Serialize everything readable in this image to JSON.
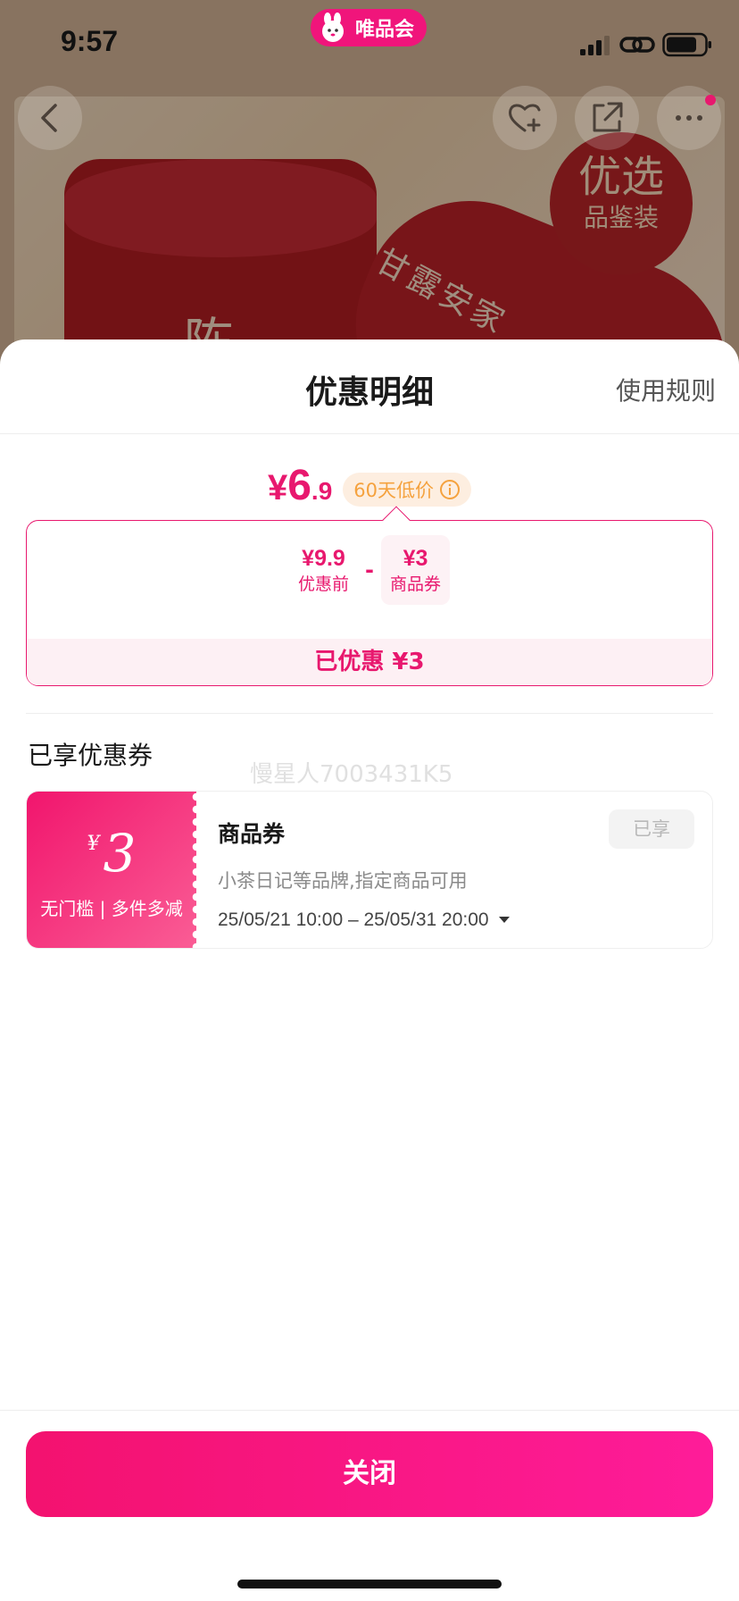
{
  "status_bar": {
    "time": "9:57",
    "app_badge_label": "唯品会"
  },
  "background": {
    "tin_char": "陈",
    "tin2_text": "甘露安家",
    "badge_line1": "优选",
    "badge_line2": "品鉴装"
  },
  "icons": {
    "back": "back-arrow-icon",
    "favorite": "heart-plus-icon",
    "share": "share-icon",
    "more": "more-dots-icon"
  },
  "sheet": {
    "title": "优惠明细",
    "rules_label": "使用规则"
  },
  "price": {
    "currency": "¥",
    "integer": "6",
    "decimal": ".9",
    "low_price_tag": "60天低价"
  },
  "breakdown": {
    "original_value": "¥9.9",
    "original_label": "优惠前",
    "minus": "-",
    "coupon_value": "¥3",
    "coupon_label": "商品券",
    "saved_text": "已优惠 ¥3"
  },
  "coupons_section": {
    "title": "已享优惠券",
    "watermark": "慢星人7003431K5"
  },
  "coupon": {
    "currency": "¥",
    "value": "3",
    "condition": "无门槛 | 多件多减",
    "name": "商品券",
    "scope": "小茶日记等品牌,指定商品可用",
    "validity": "25/05/21 10:00 – 25/05/31 20:00",
    "status": "已享"
  },
  "footer": {
    "close_label": "关闭"
  },
  "colors": {
    "brand_pink": "#e8186e",
    "low_price_orange": "#f5a23e"
  }
}
